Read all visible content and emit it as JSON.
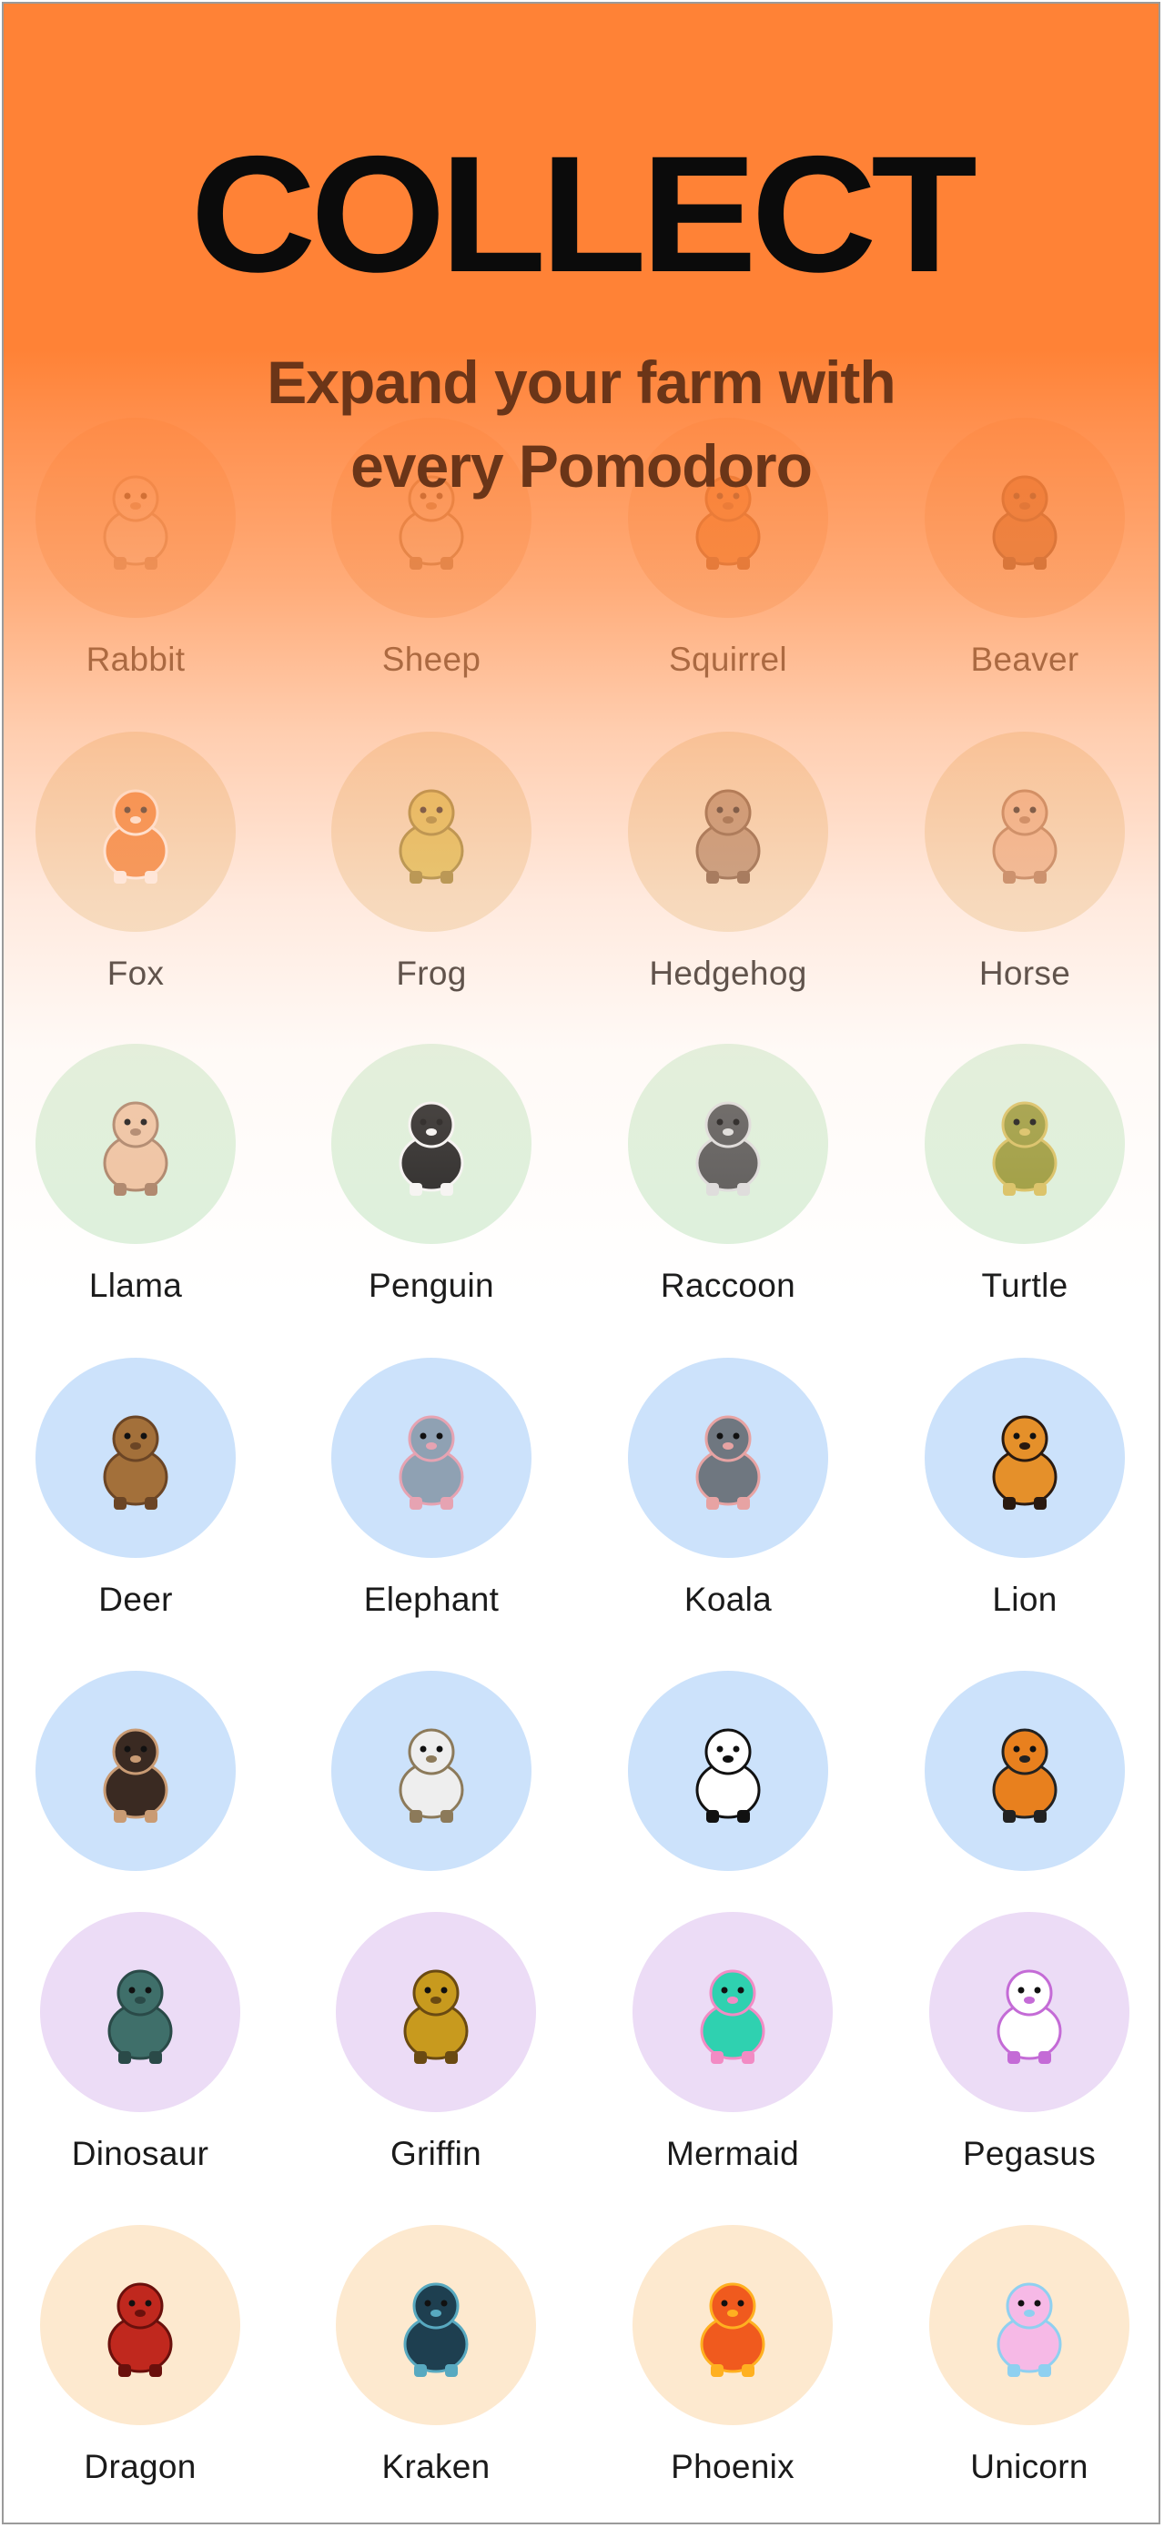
{
  "header": {
    "title": "COLLECT",
    "subtitle_line1": "Expand your farm with",
    "subtitle_line2": "every Pomodoro"
  },
  "colors": {
    "header_orange": "#ff8236",
    "tier_common": "#f6dcc8",
    "tier_uncommon": "#f2e3c6",
    "tier_rare": "#dcf1dc",
    "tier_epic": "#cce2fb",
    "tier_mythic": "#ecdcf6",
    "tier_legendary": "#fde9cf"
  },
  "animals": [
    {
      "name": "Rabbit",
      "icon": "rabbit-icon"
    },
    {
      "name": "Sheep",
      "icon": "sheep-icon"
    },
    {
      "name": "Squirrel",
      "icon": "squirrel-icon"
    },
    {
      "name": "Beaver",
      "icon": "beaver-icon"
    },
    {
      "name": "Fox",
      "icon": "fox-icon"
    },
    {
      "name": "Frog",
      "icon": "frog-icon"
    },
    {
      "name": "Hedgehog",
      "icon": "hedgehog-icon"
    },
    {
      "name": "Horse",
      "icon": "horse-icon"
    },
    {
      "name": "Llama",
      "icon": "llama-icon"
    },
    {
      "name": "Penguin",
      "icon": "penguin-icon"
    },
    {
      "name": "Raccoon",
      "icon": "raccoon-icon"
    },
    {
      "name": "Turtle",
      "icon": "turtle-icon"
    },
    {
      "name": "Deer",
      "icon": "deer-icon"
    },
    {
      "name": "Elephant",
      "icon": "elephant-icon"
    },
    {
      "name": "Koala",
      "icon": "koala-icon"
    },
    {
      "name": "Lion",
      "icon": "lion-icon"
    },
    {
      "name": "",
      "icon": "monkey-icon"
    },
    {
      "name": "",
      "icon": "owl-icon"
    },
    {
      "name": "",
      "icon": "panda-icon"
    },
    {
      "name": "",
      "icon": "tiger-icon"
    },
    {
      "name": "Dinosaur",
      "icon": "dinosaur-icon"
    },
    {
      "name": "Griffin",
      "icon": "griffin-icon"
    },
    {
      "name": "Mermaid",
      "icon": "mermaid-icon"
    },
    {
      "name": "Pegasus",
      "icon": "pegasus-icon"
    },
    {
      "name": "Dragon",
      "icon": "dragon-icon"
    },
    {
      "name": "Kraken",
      "icon": "kraken-icon"
    },
    {
      "name": "Phoenix",
      "icon": "phoenix-icon"
    },
    {
      "name": "Unicorn",
      "icon": "unicorn-icon"
    }
  ]
}
